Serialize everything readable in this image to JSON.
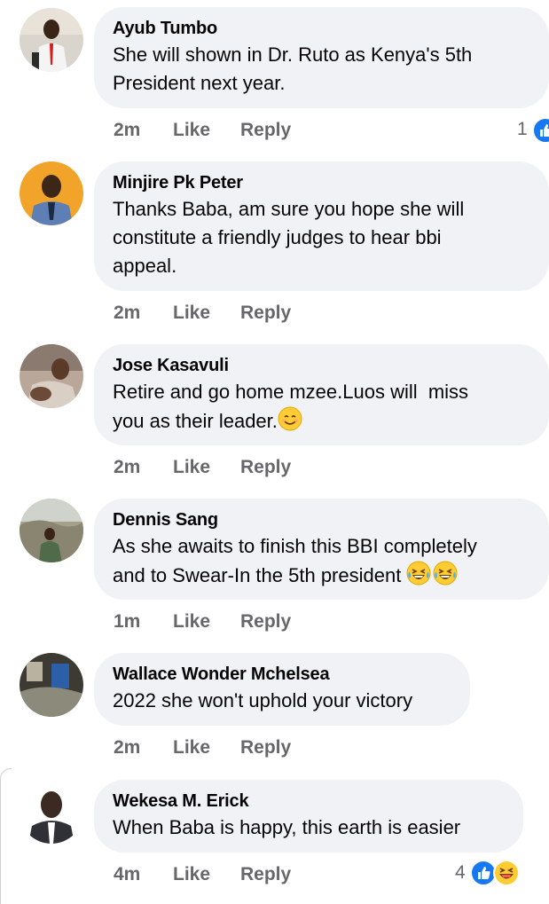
{
  "comments": [
    {
      "author": "Ayub Tumbo",
      "text": "She will shown in Dr. Ruto as Kenya's 5th\nPresident next year.",
      "time": "2m",
      "like": "Like",
      "reply": "Reply",
      "reaction_count": "1",
      "avatar_icon": "person-red-tie-avatar"
    },
    {
      "author": "Minjire Pk Peter",
      "text": "Thanks Baba, am sure you hope she will\nconstitute a friendly judges to hear bbi\nappeal.",
      "time": "2m",
      "like": "Like",
      "reply": "Reply",
      "avatar_icon": "person-orange-bg-avatar"
    },
    {
      "author": "Jose Kasavuli",
      "text": "Retire and go home mzee.Luos will  miss\nyou as their leader.",
      "time": "2m",
      "like": "Like",
      "reply": "Reply",
      "avatar_icon": "person-photo-avatar",
      "emoji": "smiling-face"
    },
    {
      "author": "Dennis Sang",
      "text": "As she awaits to finish this BBI completely\nand to Swear-In the 5th president ",
      "time": "1m",
      "like": "Like",
      "reply": "Reply",
      "avatar_icon": "person-outdoor-avatar",
      "emoji": "laughing-tears x2"
    },
    {
      "author": "Wallace Wonder Mchelsea",
      "text": "2022 she won't uphold your victory",
      "time": "2m",
      "like": "Like",
      "reply": "Reply",
      "avatar_icon": "dark-photo-avatar"
    },
    {
      "author": "Wekesa M. Erick",
      "text": "When Baba is happy, this earth is easier",
      "time": "4m",
      "like": "Like",
      "reply": "Reply",
      "reaction_count": "4",
      "avatar_icon": "person-suit-avatar",
      "reactions": [
        "like",
        "haha"
      ]
    }
  ],
  "colors": {
    "bubble": "#f0f2f5",
    "meta": "#65676b",
    "like_blue": "#1877f2"
  }
}
